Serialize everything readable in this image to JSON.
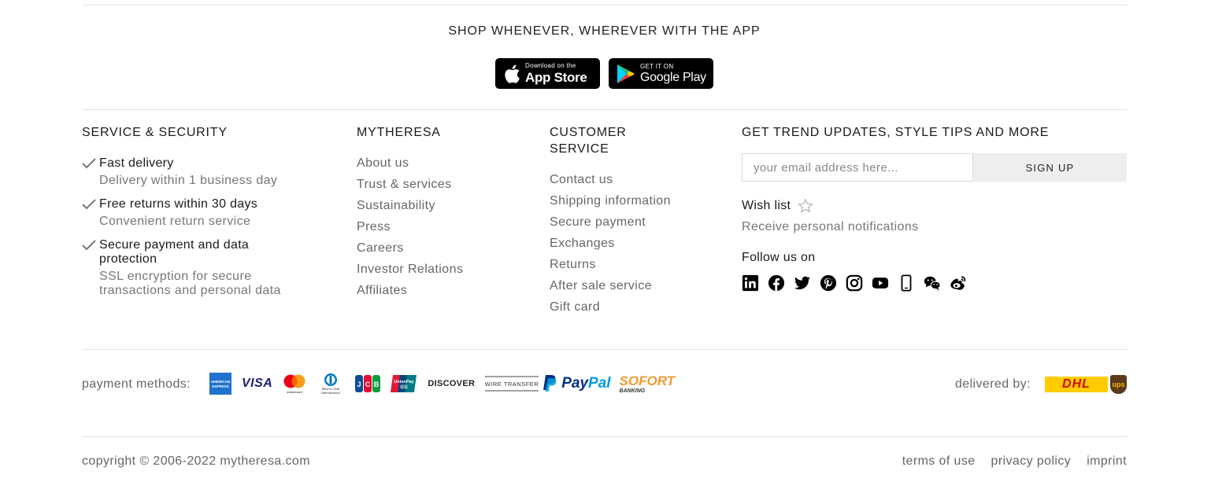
{
  "app_section": {
    "title": "SHOP WHENEVER, WHEREVER WITH THE APP",
    "app_store": {
      "small": "Download on the",
      "big": "App Store"
    },
    "google_play": {
      "small": "GET IT ON",
      "big": "Google Play"
    }
  },
  "service_security": {
    "title": "SERVICE & SECURITY",
    "items": [
      {
        "title": "Fast delivery",
        "sub": "Delivery within 1 business day"
      },
      {
        "title": "Free returns within 30 days",
        "sub": "Convenient return service"
      },
      {
        "title": "Secure payment and data protection",
        "sub": "SSL encryption for secure transactions and personal data"
      }
    ]
  },
  "mytheresa": {
    "title": "MYTHERESA",
    "links": [
      "About us",
      "Trust & services",
      "Sustainability",
      "Press",
      "Careers",
      "Investor Relations",
      "Affiliates"
    ]
  },
  "customer_service": {
    "title": "CUSTOMER SERVICE",
    "links": [
      "Contact us",
      "Shipping information",
      "Secure payment",
      "Exchanges",
      "Returns",
      "After sale service",
      "Gift card"
    ]
  },
  "newsletter": {
    "title": "GET TREND UPDATES, STYLE TIPS AND MORE",
    "email_placeholder": "your email address here...",
    "email_value": "",
    "signup_label": "SIGN UP",
    "wishlist_label": "Wish list",
    "wishlist_sub": "Receive personal notifications",
    "follow_label": "Follow us on",
    "social_icons": [
      "linkedin-icon",
      "facebook-icon",
      "twitter-icon",
      "pinterest-icon",
      "instagram-icon",
      "youtube-icon",
      "mobile-icon",
      "wechat-icon",
      "weibo-icon"
    ]
  },
  "payment": {
    "label": "payment methods:",
    "methods": {
      "amex": "AMERICAN EXPRESS",
      "visa": "VISA",
      "mastercard": "mastercard",
      "diners": "Diners Club International",
      "jcb": "JCB",
      "unionpay": "UnionPay",
      "discover": "DISCOVER",
      "wire": "WIRE TRANSFER",
      "paypal_pay": "Pay",
      "paypal_pal": "Pal",
      "sofort": "SOFORT",
      "sofort_sub": "BANKING"
    }
  },
  "delivery": {
    "label": "delivered by:",
    "dhl": "DHL",
    "ups": "ups"
  },
  "footer": {
    "copyright": "copyright © 2006-2022 mytheresa.com",
    "links": [
      "terms of use",
      "privacy policy",
      "imprint"
    ]
  },
  "colors": {
    "text": "#1a1a1a",
    "muted": "#666666",
    "divider": "#e3e3e3",
    "signup_bg": "#eeeeee",
    "dhl_yellow": "#ffcc00",
    "dhl_red": "#d40511"
  }
}
